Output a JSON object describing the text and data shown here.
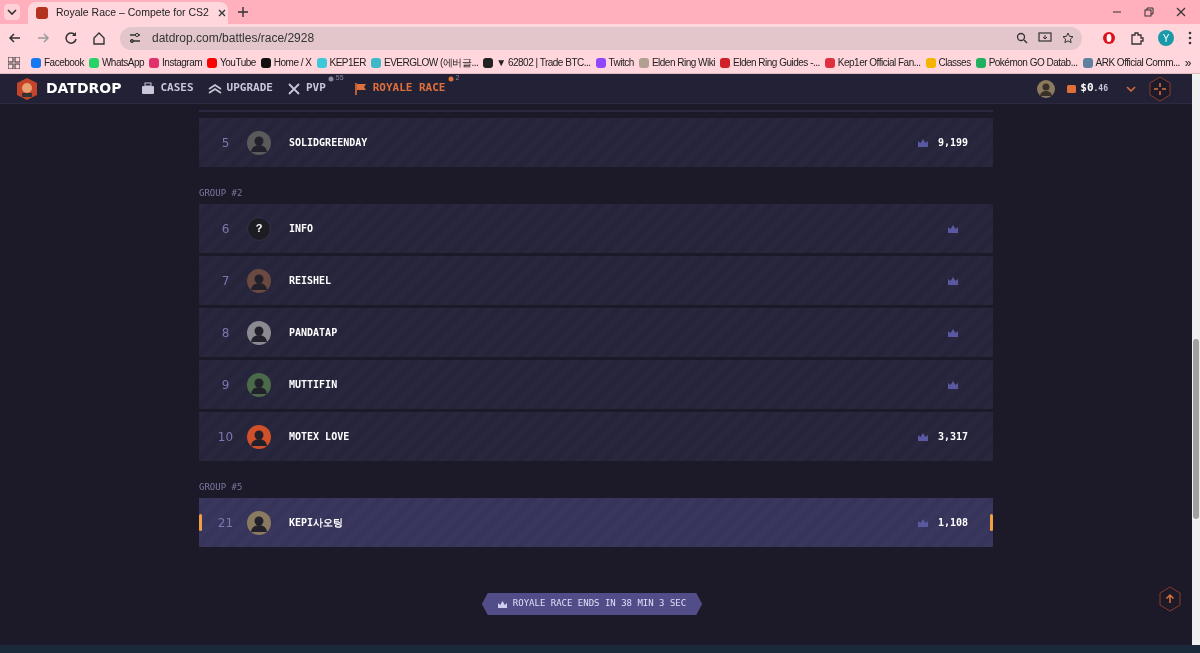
{
  "browser": {
    "tabs": [
      {
        "title": "Royale Race – Compete for CS2",
        "selected": true
      }
    ],
    "address": "datdrop.com/battles/race/2928",
    "profile": "Y",
    "bookmarks": [
      {
        "label": "Facebook",
        "color": "#1877f2"
      },
      {
        "label": "WhatsApp",
        "color": "#25d366"
      },
      {
        "label": "Instagram",
        "color": "#e1306c"
      },
      {
        "label": "YouTube",
        "color": "#ff0000"
      },
      {
        "label": "Home / X",
        "color": "#111111"
      },
      {
        "label": "KEP1ER",
        "color": "#3cc8d8"
      },
      {
        "label": "EVERGLOW (에버글...",
        "color": "#3cb8c8"
      },
      {
        "label": "▼ 62802 | Trade BTC...",
        "color": "#222222"
      },
      {
        "label": "Twitch",
        "color": "#9146ff"
      },
      {
        "label": "Elden Ring Wiki",
        "color": "#b0a090"
      },
      {
        "label": "Elden Ring Guides -...",
        "color": "#d0202a"
      },
      {
        "label": "Kep1er Official Fan...",
        "color": "#e03040"
      },
      {
        "label": "Classes",
        "color": "#f4b400"
      },
      {
        "label": "Pokémon GO Datab...",
        "color": "#20b060"
      },
      {
        "label": "ARK Official Comm...",
        "color": "#6080a0"
      }
    ],
    "more": "»"
  },
  "site": {
    "logo": "DATDROP",
    "nav": [
      {
        "label": "CASES",
        "selected": false
      },
      {
        "label": "UPGRADE",
        "selected": false
      },
      {
        "label": "PVP",
        "selected": false,
        "badge": "55"
      },
      {
        "label": "ROYALE RACE",
        "selected": true,
        "badge": "2"
      }
    ],
    "balance": {
      "whole": "$0",
      "fraction": ".46"
    }
  },
  "groups": [
    {
      "rows": [
        {
          "rank": "5",
          "name": "SOLIDGREENDAY",
          "score": "9,199",
          "avatar": {
            "kind": "photo",
            "color": "#5a5a5a"
          },
          "selected": false
        }
      ]
    },
    {
      "title": "GROUP #2",
      "rows": [
        {
          "rank": "6",
          "name": "INFO",
          "avatar": {
            "kind": "unknown",
            "text": "?"
          },
          "selected": false
        },
        {
          "rank": "7",
          "name": "REISHEL",
          "avatar": {
            "kind": "photo",
            "color": "#6a4a40"
          },
          "selected": false
        },
        {
          "rank": "8",
          "name": "PANDATAP",
          "avatar": {
            "kind": "photo",
            "color": "#8a8a90"
          },
          "selected": false
        },
        {
          "rank": "9",
          "name": "MUTTIFIN",
          "avatar": {
            "kind": "photo",
            "color": "#4a6a4a"
          },
          "selected": false
        },
        {
          "rank": "10",
          "name": "MOTEX LOVE",
          "score": "3,317",
          "avatar": {
            "kind": "photo",
            "color": "#d0502a"
          },
          "selected": false
        }
      ]
    },
    {
      "title": "GROUP #5",
      "rows": [
        {
          "rank": "21",
          "name": "KEPI사오팅",
          "score": "1,108",
          "avatar": {
            "kind": "photo",
            "color": "#8a7a60"
          },
          "selected": true
        }
      ]
    }
  ],
  "timer": "ROYALE RACE ENDS IN 38 MIN 3 SEC"
}
